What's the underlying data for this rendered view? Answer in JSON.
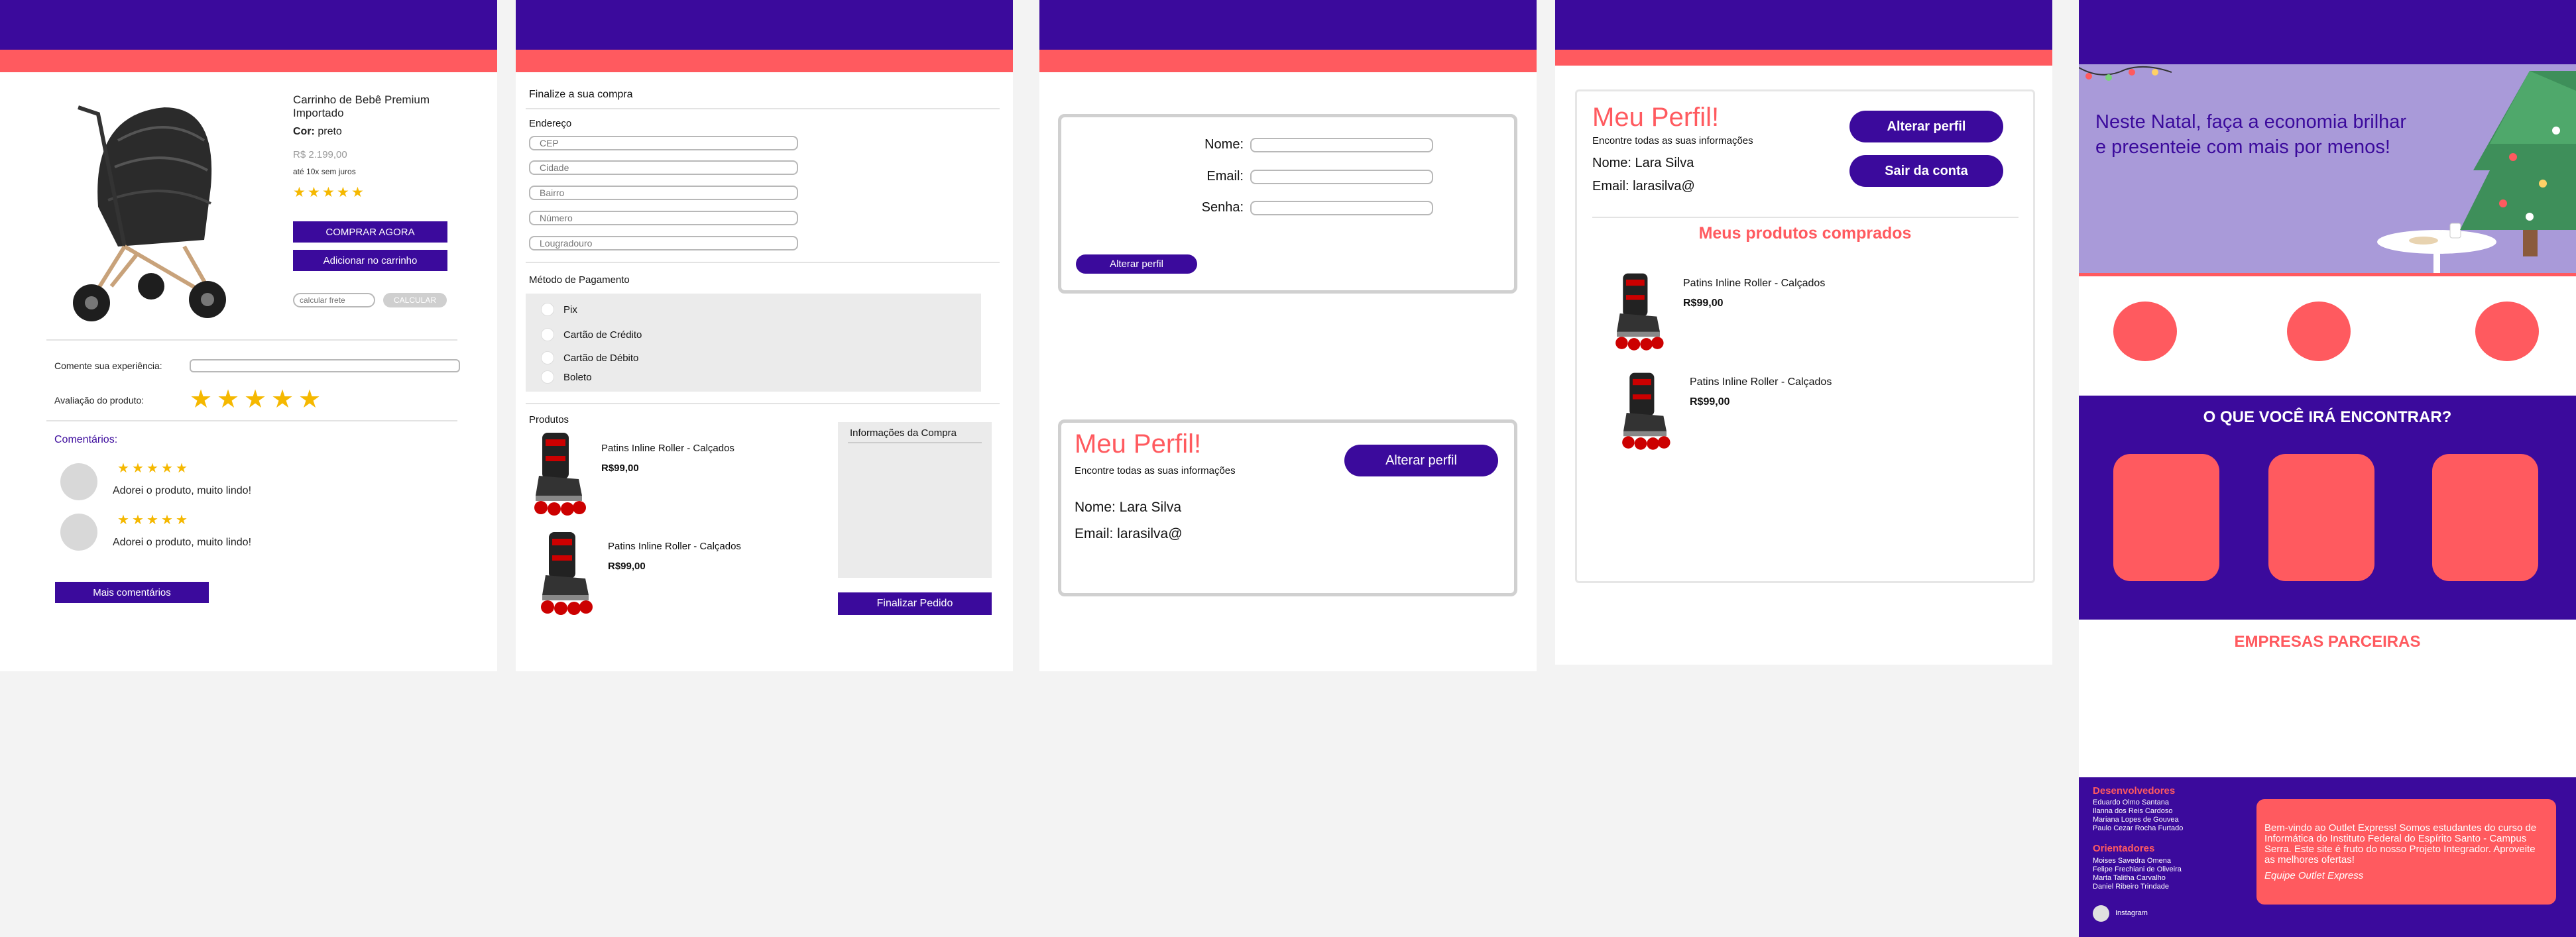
{
  "product_page": {
    "title": "Carrinho de Bebê Premium Importado",
    "color_label": "Cor:",
    "color_value": "preto",
    "old_price": "R$ 2.199,00",
    "installments": "até 10x sem juros",
    "rating_stars": 5,
    "buy_now": "COMPRAR AGORA",
    "add_to_cart": "Adicionar no carrinho",
    "freight_placeholder": "calcular frete",
    "calc_button": "CALCULAR",
    "comment_label": "Comente sua experiência:",
    "rating_label": "Avaliação do produto:",
    "comments_title": "Comentários:",
    "comments": [
      {
        "stars": 5,
        "text": "Adorei o produto, muito lindo!"
      },
      {
        "stars": 5,
        "text": "Adorei o produto, muito lindo!"
      }
    ],
    "more_comments": "Mais comentários"
  },
  "checkout_page": {
    "title": "Finalize a sua compra",
    "address_title": "Endereço",
    "address_fields": [
      "CEP",
      "Cidade",
      "Bairro",
      "Número",
      "Lougradouro"
    ],
    "payment_title": "Método de Pagamento",
    "payment_options": [
      "Pix",
      "Cartão de Crédito",
      "Cartão de Débito",
      "Boleto"
    ],
    "products_title": "Produtos",
    "products": [
      {
        "name": "Patins Inline Roller - Calçados",
        "price": "R$99,00"
      },
      {
        "name": "Patins Inline Roller - Calçados",
        "price": "R$99,00"
      }
    ],
    "info_title": "Informações da Compra",
    "finish_button": "Finalizar Pedido"
  },
  "edit_profile_page": {
    "labels": {
      "name": "Nome:",
      "email": "Email:",
      "password": "Senha:"
    },
    "alter_button": "Alterar perfil",
    "profile_title": "Meu Perfil!",
    "profile_subtitle": "Encontre todas as suas informações",
    "profile_alter_button": "Alterar perfil",
    "name_line": "Nome: Lara Silva",
    "email_line": "Email: larasilva@"
  },
  "profile_page": {
    "title": "Meu Perfil!",
    "subtitle": "Encontre todas as suas informações",
    "name_line": "Nome: Lara Silva",
    "email_line": "Email: larasilva@",
    "alter_button": "Alterar perfil",
    "logout_button": "Sair da conta",
    "purchased_title": "Meus produtos comprados",
    "products": [
      {
        "name": "Patins Inline Roller - Calçados",
        "price": "R$99,00"
      },
      {
        "name": "Patins Inline Roller - Calçados",
        "price": "R$99,00"
      }
    ]
  },
  "home_page": {
    "banner_text": "Neste Natal, faça a economia brilhar e presenteie com mais por menos!",
    "find_title": "O QUE VOCÊ IRÁ ENCONTRAR?",
    "partners_title": "EMPRESAS PARCEIRAS",
    "developers_title": "Desenvolvedores",
    "developers": [
      "Eduardo Olmo Santana",
      "Ilanna dos Reis Cardoso",
      "Mariana Lopes de Gouvea",
      "Paulo Cezar Rocha Furtado"
    ],
    "advisors_title": "Orientadores",
    "advisors": [
      "Moises Savedra Omena",
      "Felipe Frechiani de Oliveira",
      "Marta Talitha Carvalho",
      "Daniel Ribeiro Trindade"
    ],
    "instagram_label": "Instagram",
    "about_text": "Bem-vindo ao Outlet Express! Somos estudantes do curso de Informática do Instituto Federal do Espírito Santo - Campus Serra. Este site é fruto do nosso Projeto Integrador. Aproveite as melhores ofertas!",
    "about_signature": "Equipe Outlet Express"
  },
  "colors": {
    "primary": "#3b0a9c",
    "accent": "#ff5a5f",
    "star": "#f5b800"
  }
}
